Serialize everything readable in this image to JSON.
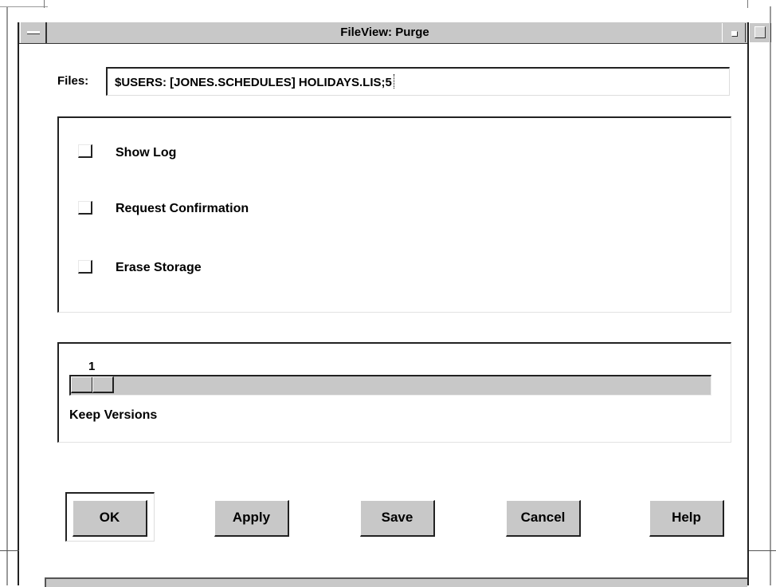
{
  "window": {
    "title": "FileView: Purge"
  },
  "files": {
    "label": "Files:",
    "value": "$USERS: [JONES.SCHEDULES] HOLIDAYS.LIS;5"
  },
  "options": [
    {
      "label": "Show Log",
      "checked": false
    },
    {
      "label": "Request Confirmation",
      "checked": false
    },
    {
      "label": "Erase Storage",
      "checked": false
    }
  ],
  "keep_versions": {
    "value": "1",
    "label": "Keep Versions"
  },
  "buttons": {
    "ok": "OK",
    "apply": "Apply",
    "save": "Save",
    "cancel": "Cancel",
    "help": "Help"
  },
  "colors": {
    "chrome": "#c8c8c8",
    "shadow": "#222222",
    "background": "#ffffff"
  }
}
